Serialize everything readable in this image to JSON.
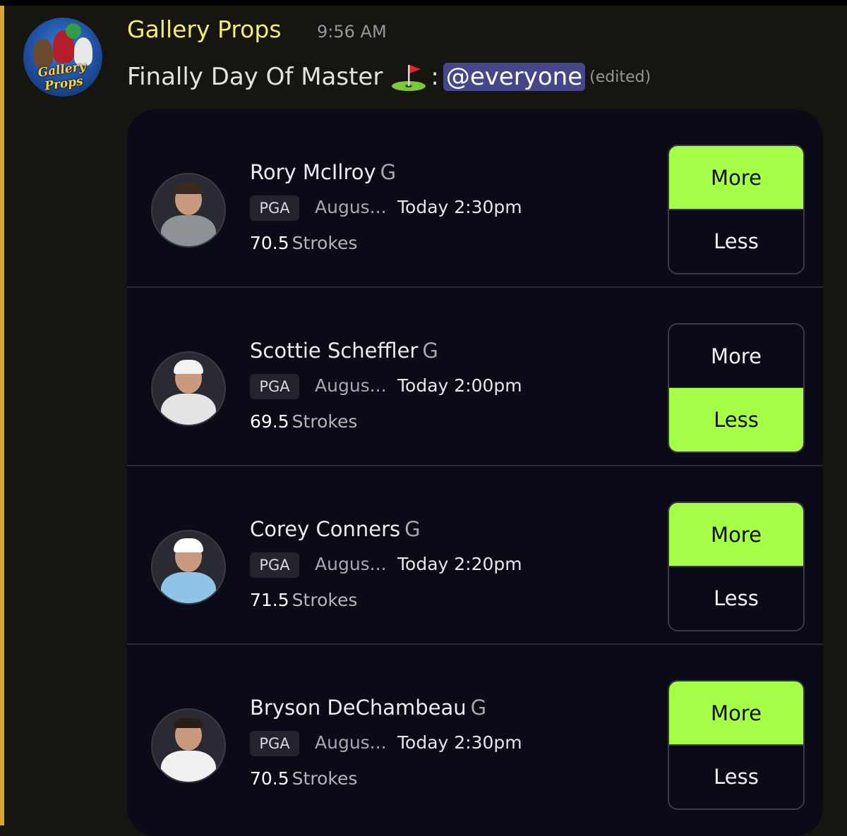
{
  "message": {
    "username": "Gallery Props",
    "timestamp": "9:56 AM",
    "text": "Finally Day Of Master",
    "colon": ":",
    "mention": "@everyone",
    "edited": "(edited)",
    "avatar_logo_text": "Gallery Props",
    "flag_emoji": "golf-flag-emoji"
  },
  "colors": {
    "username": "#f3ec75",
    "mention_bg": "#45478b",
    "selected_pick": "#a6ff47",
    "card_bg": "#0b0b18",
    "highlight_bar": "#d8a533"
  },
  "picks": [
    {
      "name": "Rory McIlroy",
      "position": "G",
      "league": "PGA",
      "event": "Augus...",
      "time": "Today 2:30pm",
      "line": "70.5",
      "stat": "Strokes",
      "more_label": "More",
      "less_label": "Less",
      "selected": "More"
    },
    {
      "name": "Scottie Scheffler",
      "position": "G",
      "league": "PGA",
      "event": "Augus...",
      "time": "Today 2:00pm",
      "line": "69.5",
      "stat": "Strokes",
      "more_label": "More",
      "less_label": "Less",
      "selected": "Less"
    },
    {
      "name": "Corey Conners",
      "position": "G",
      "league": "PGA",
      "event": "Augus...",
      "time": "Today 2:20pm",
      "line": "71.5",
      "stat": "Strokes",
      "more_label": "More",
      "less_label": "Less",
      "selected": "More"
    },
    {
      "name": "Bryson DeChambeau",
      "position": "G",
      "league": "PGA",
      "event": "Augus...",
      "time": "Today 2:30pm",
      "line": "70.5",
      "stat": "Strokes",
      "more_label": "More",
      "less_label": "Less",
      "selected": "More"
    }
  ]
}
